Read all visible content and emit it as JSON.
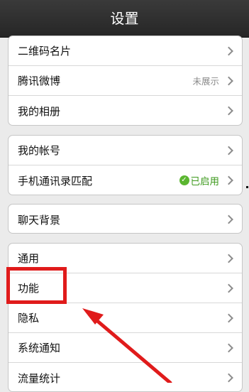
{
  "header": {
    "title": "设置"
  },
  "groups": [
    {
      "items": [
        {
          "label": "二维码名片",
          "value": ""
        },
        {
          "label": "腾讯微博",
          "value": "未展示"
        },
        {
          "label": "我的相册",
          "value": ""
        }
      ]
    },
    {
      "items": [
        {
          "label": "我的帐号",
          "value": ""
        },
        {
          "label": "手机通讯录匹配",
          "value": "已启用"
        }
      ]
    },
    {
      "items": [
        {
          "label": "聊天背景",
          "value": ""
        }
      ]
    },
    {
      "items": [
        {
          "label": "通用",
          "value": ""
        },
        {
          "label": "功能",
          "value": ""
        },
        {
          "label": "隐私",
          "value": ""
        },
        {
          "label": "系统通知",
          "value": ""
        },
        {
          "label": "流量统计",
          "value": ""
        }
      ]
    }
  ],
  "colors": {
    "highlight": "#e01b1b",
    "enabled": "#5bb630"
  },
  "icons": {
    "chevron": "chevron-right-icon",
    "check": "check-circle-icon"
  }
}
